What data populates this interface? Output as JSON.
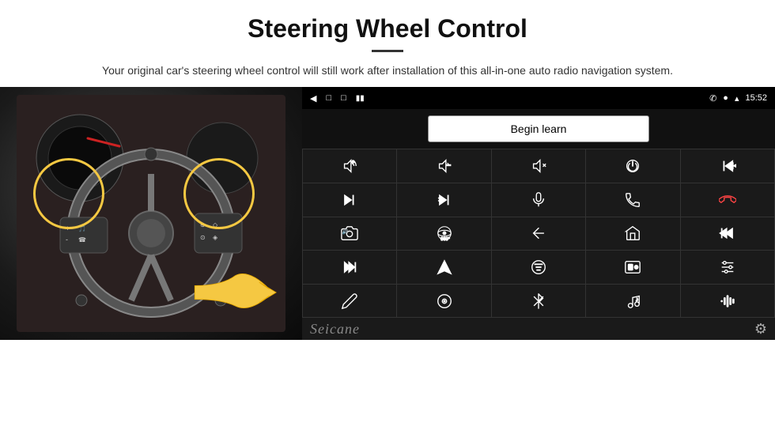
{
  "header": {
    "title": "Steering Wheel Control",
    "subtitle": "Your original car's steering wheel control will still work after installation of this all-in-one auto radio navigation system."
  },
  "android_panel": {
    "status_bar": {
      "time": "15:52"
    },
    "begin_learn_label": "Begin learn",
    "watermark": "Seicane",
    "icon_grid": [
      {
        "id": "vol-up",
        "label": "Volume Up"
      },
      {
        "id": "vol-down",
        "label": "Volume Down"
      },
      {
        "id": "vol-mute",
        "label": "Volume Mute"
      },
      {
        "id": "power",
        "label": "Power"
      },
      {
        "id": "prev-track",
        "label": "Previous Track"
      },
      {
        "id": "next-track",
        "label": "Next Track"
      },
      {
        "id": "shuffle",
        "label": "Shuffle"
      },
      {
        "id": "mic",
        "label": "Microphone"
      },
      {
        "id": "phone",
        "label": "Phone"
      },
      {
        "id": "hang-up",
        "label": "Hang Up"
      },
      {
        "id": "camera",
        "label": "Camera"
      },
      {
        "id": "360",
        "label": "360 View"
      },
      {
        "id": "back",
        "label": "Back"
      },
      {
        "id": "home",
        "label": "Home"
      },
      {
        "id": "skip-back",
        "label": "Skip Back"
      },
      {
        "id": "fast-forward",
        "label": "Fast Forward"
      },
      {
        "id": "nav",
        "label": "Navigation"
      },
      {
        "id": "eq",
        "label": "Equalizer"
      },
      {
        "id": "record",
        "label": "Record"
      },
      {
        "id": "settings-tune",
        "label": "Tune Settings"
      },
      {
        "id": "pen",
        "label": "Pen"
      },
      {
        "id": "radio",
        "label": "Radio"
      },
      {
        "id": "bluetooth",
        "label": "Bluetooth"
      },
      {
        "id": "music",
        "label": "Music"
      },
      {
        "id": "voice-eq",
        "label": "Voice EQ"
      }
    ]
  }
}
